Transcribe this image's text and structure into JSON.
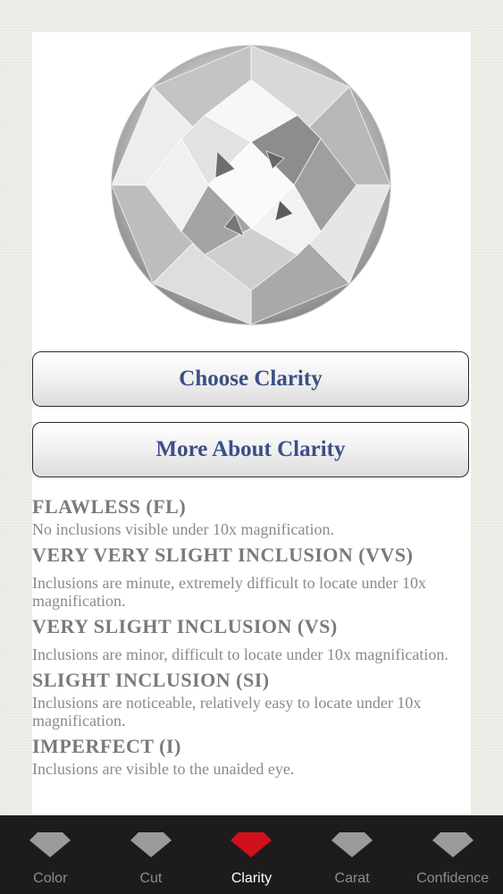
{
  "buttons": {
    "choose": "Choose Clarity",
    "more": "More About Clarity"
  },
  "grades": [
    {
      "title": "FLAWLESS (FL)",
      "desc": "No inclusions visible under 10x magnification."
    },
    {
      "title": "VERY VERY SLIGHT INCLUSION (VVS)",
      "desc": "Inclusions are minute, extremely difficult to locate under 10x magnification."
    },
    {
      "title": "VERY SLIGHT INCLUSION (VS)",
      "desc": "Inclusions are minor, difficult to locate under 10x magnification."
    },
    {
      "title": "SLIGHT INCLUSION (SI)",
      "desc": "Inclusions are noticeable, relatively easy to locate under 10x magnification."
    },
    {
      "title": "IMPERFECT (I)",
      "desc": "Inclusions are visible to the unaided eye."
    }
  ],
  "tabs": [
    {
      "label": "Color",
      "active": false
    },
    {
      "label": "Cut",
      "active": false
    },
    {
      "label": "Clarity",
      "active": true
    },
    {
      "label": "Carat",
      "active": false
    },
    {
      "label": "Confidence",
      "active": false
    }
  ],
  "colors": {
    "accent_tab": "#d0101c",
    "inactive_tab": "#9a9a9a",
    "button_text": "#3b4f86",
    "heading_text": "#7a7a7a"
  },
  "icons": {
    "tab": "diamond-icon",
    "hero": "diamond-image"
  }
}
